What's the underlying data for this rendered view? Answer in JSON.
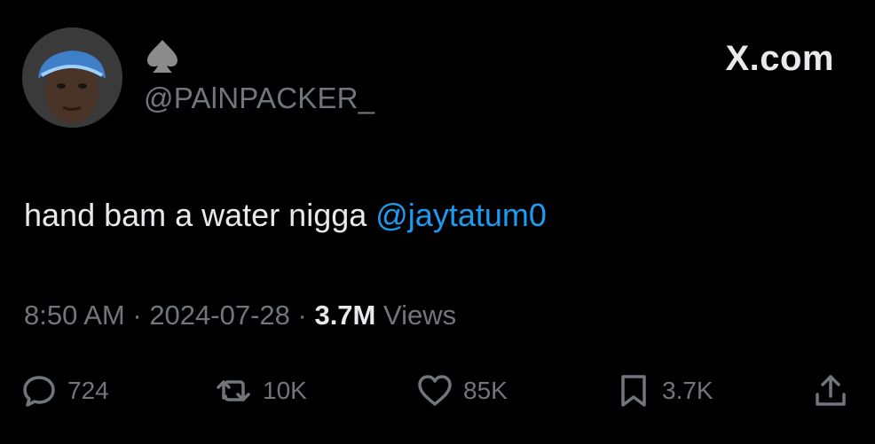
{
  "profile": {
    "handle": "@PAlNPACKER_",
    "badge_icon": "spade-icon",
    "avatar_icon": "user-avatar"
  },
  "brand": {
    "label": "X.com"
  },
  "tweet": {
    "text": "hand bam a water nigga ",
    "mention": "@jaytatum0"
  },
  "meta": {
    "time": "8:50 AM",
    "sep1": " · ",
    "date": "2024-07-28",
    "sep2": " · ",
    "views_count": "3.7M",
    "views_label": " Views"
  },
  "actions": {
    "replies": "724",
    "reposts": "10K",
    "likes": "85K",
    "bookmarks": "3.7K"
  },
  "colors": {
    "background": "#000000",
    "text": "#e7e9ea",
    "muted": "#71767b",
    "link": "#1d9bf0"
  }
}
